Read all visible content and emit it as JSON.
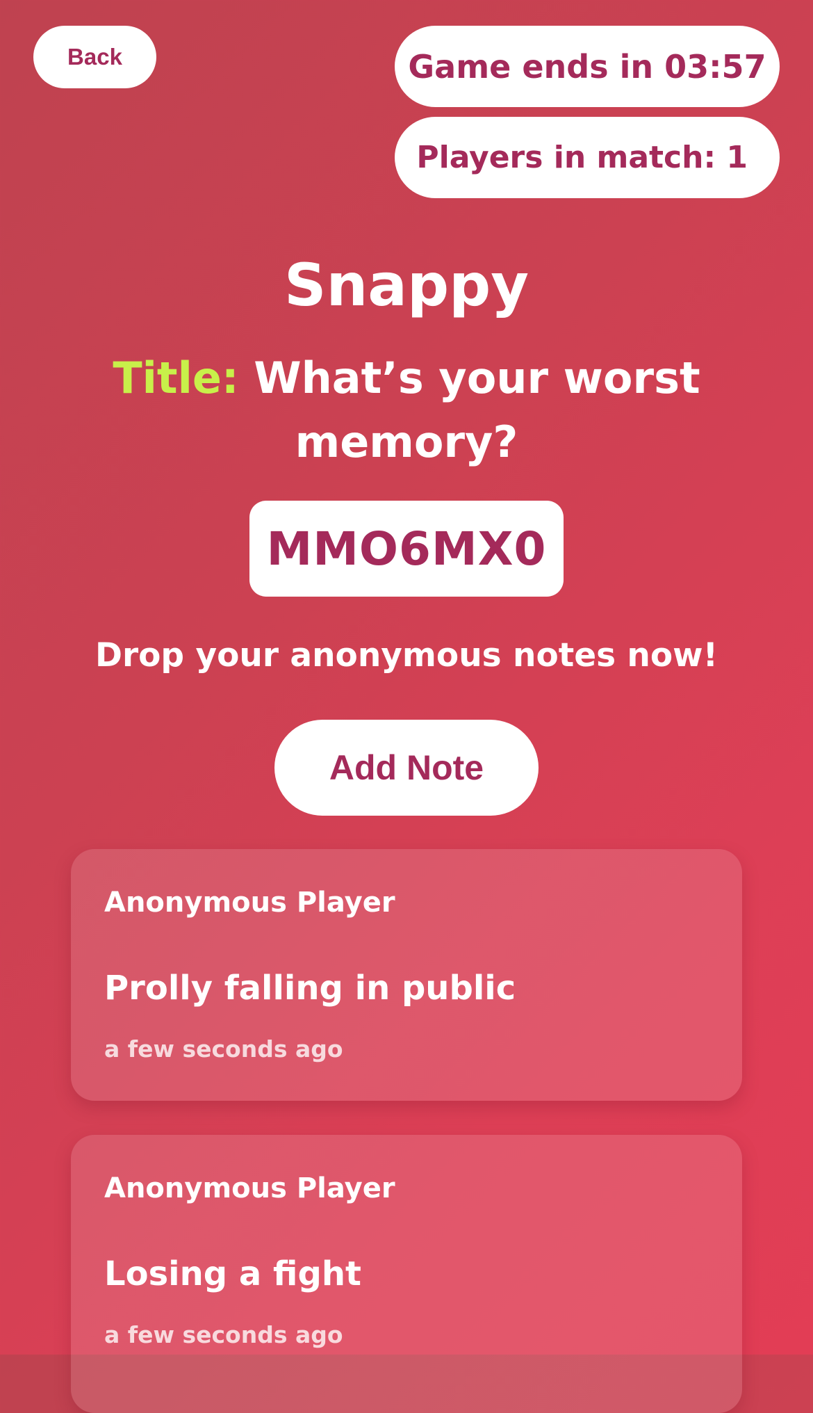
{
  "header": {
    "back_label": "Back",
    "timer_text": "Game ends in 03:57",
    "players_text": "Players in match: 1"
  },
  "game": {
    "name": "Snappy",
    "prompt_label": "Title:",
    "prompt_text": "What’s your worst memory?",
    "room_code": "MMO6MX0",
    "instructions": "Drop your anonymous notes now!",
    "add_note_label": "Add Note"
  },
  "notes": [
    {
      "author": "Anonymous Player",
      "text": "Prolly falling in public",
      "time": "a few seconds ago"
    },
    {
      "author": "Anonymous Player",
      "text": "Losing a fight",
      "time": "a few seconds ago"
    }
  ],
  "colors": {
    "background_start": "#bf4250",
    "background_end": "#e23d55",
    "accent_text": "#a42a5a",
    "prompt_label": "#c8f04a"
  }
}
